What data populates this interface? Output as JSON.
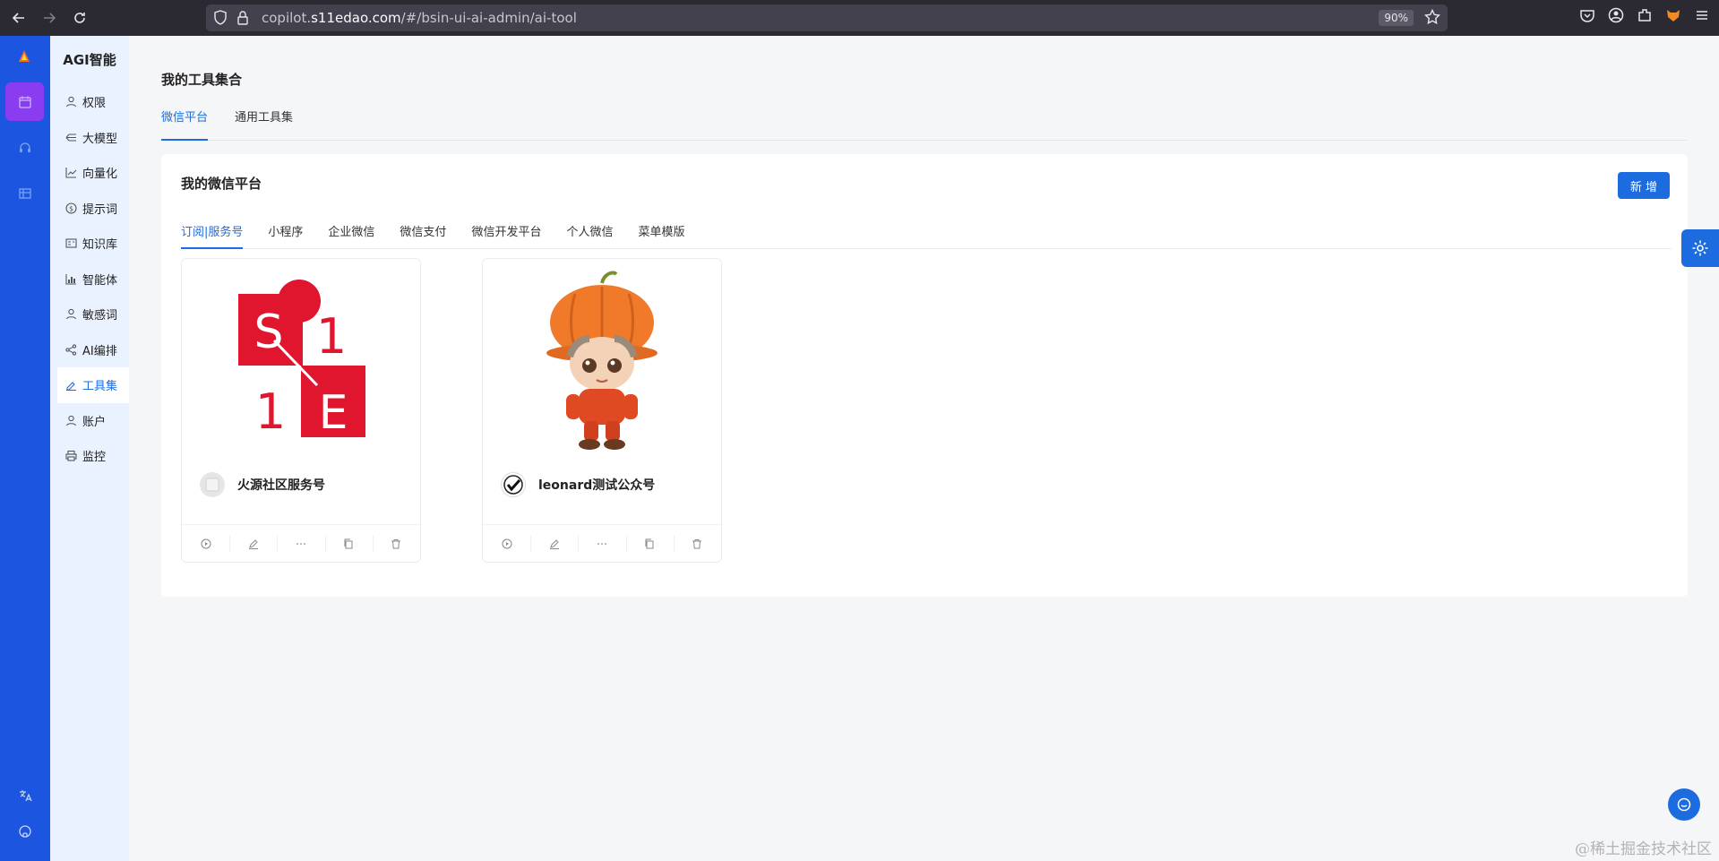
{
  "browser": {
    "url_prefix": "copilot.",
    "url_domain": "s11edao.com",
    "url_path": "/#/bsin-ui-ai-admin/ai-tool",
    "zoom": "90%"
  },
  "rail": {
    "items": [
      "calendar-icon",
      "headset-icon",
      "grid-icon"
    ],
    "bottom": [
      "translate-icon",
      "github-icon",
      "robot-icon"
    ]
  },
  "sidebar": {
    "title": "AGI智能",
    "items": [
      {
        "label": "权限",
        "icon": "user-icon"
      },
      {
        "label": "大模型",
        "icon": "model-icon"
      },
      {
        "label": "向量化",
        "icon": "chart-icon"
      },
      {
        "label": "提示词",
        "icon": "coin-icon"
      },
      {
        "label": "知识库",
        "icon": "book-icon"
      },
      {
        "label": "智能体",
        "icon": "bar-chart-icon"
      },
      {
        "label": "敏感词",
        "icon": "user-icon"
      },
      {
        "label": "AI编排",
        "icon": "share-icon"
      },
      {
        "label": "工具集",
        "icon": "tool-icon",
        "active": true
      },
      {
        "label": "账户",
        "icon": "user-icon"
      },
      {
        "label": "监控",
        "icon": "printer-icon"
      }
    ]
  },
  "main": {
    "page_title": "我的工具集合",
    "tabs": [
      "微信平台",
      "通用工具集"
    ],
    "active_tab": "微信平台",
    "panel": {
      "title": "我的微信平台",
      "add_label": "新 增",
      "sub_tabs": [
        "订阅|服务号",
        "小程序",
        "企业微信",
        "微信支付",
        "微信开发平台",
        "个人微信",
        "菜单模版"
      ],
      "active_sub_tab": "订阅|服务号",
      "cards": [
        {
          "title": "火源社区服务号",
          "cover": "s11e-logo",
          "avatar_checked": false
        },
        {
          "title": "leonard测试公众号",
          "cover": "pumpkin-character",
          "avatar_checked": true
        }
      ]
    }
  },
  "watermark": "@稀土掘金技术社区",
  "colors": {
    "primary": "#1c6ce0",
    "rail": "#1c56e0",
    "rail_active": "#8a3df0",
    "logo_red": "#e0162f"
  }
}
